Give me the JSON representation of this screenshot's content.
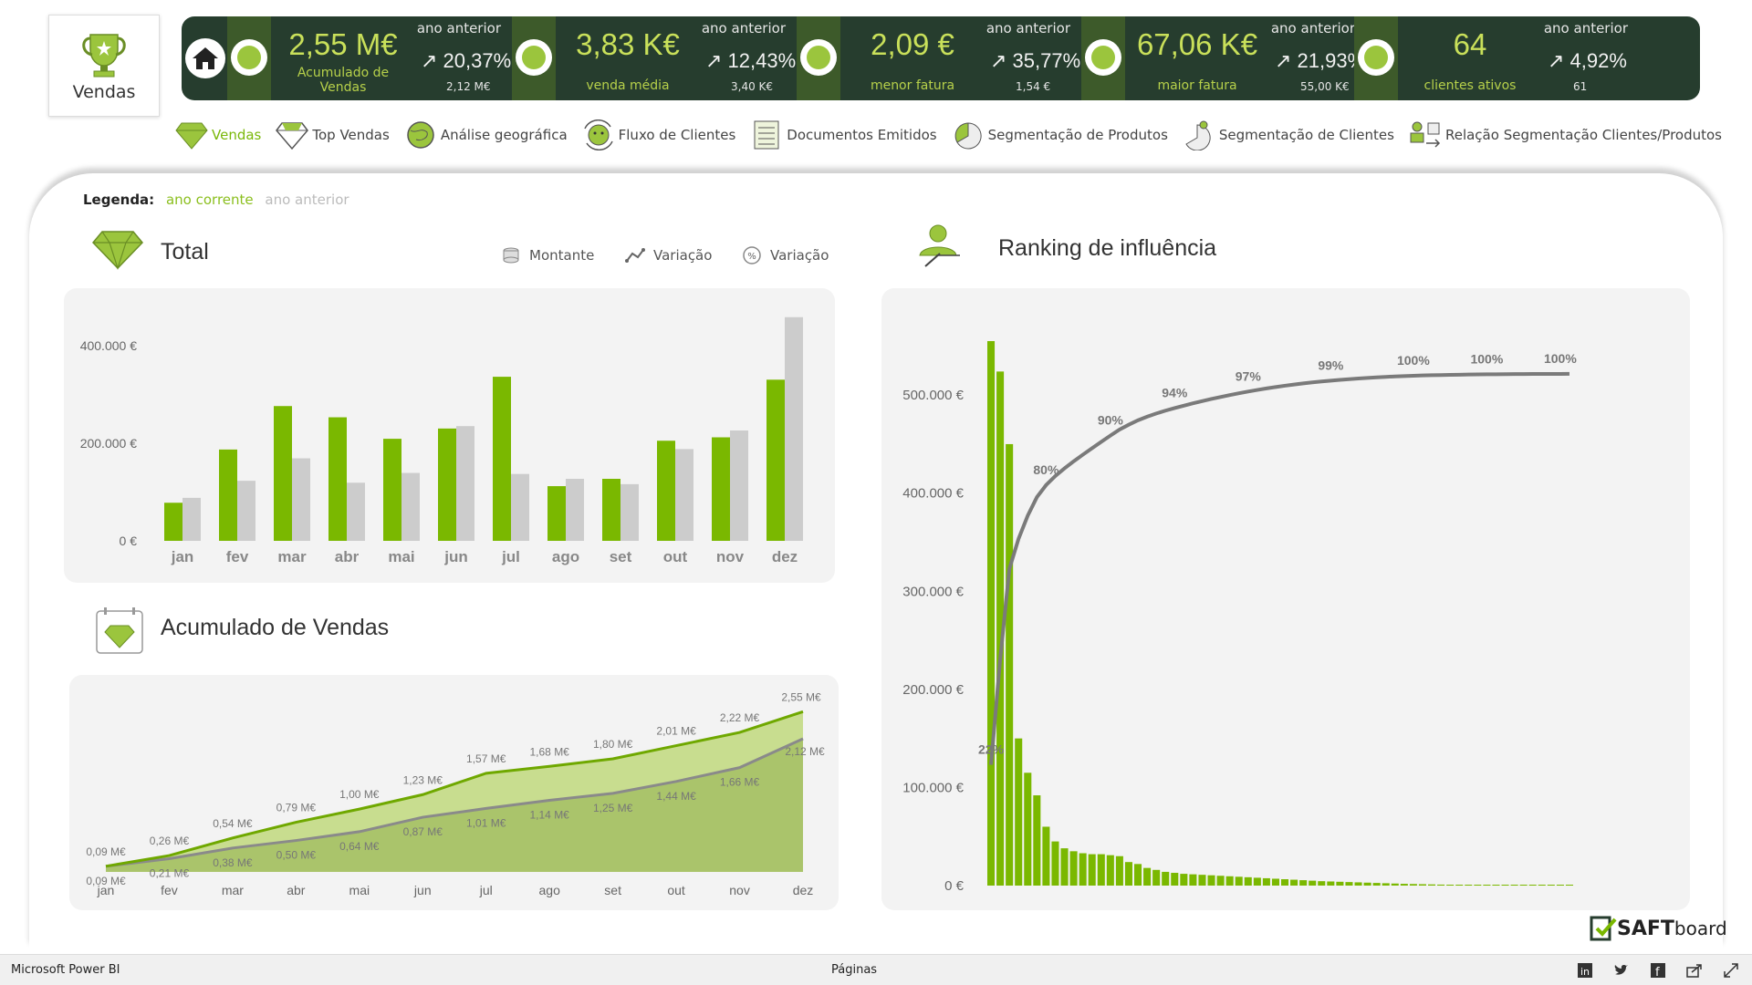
{
  "logo": {
    "label": "Vendas"
  },
  "kpis": [
    {
      "value": "2,55 M€",
      "label": "Acumulado de Vendas",
      "prev_title": "ano anterior",
      "prev_pct": "↗ 20,37%",
      "prev_val": "2,12 M€"
    },
    {
      "value": "3,83 K€",
      "label": "venda média",
      "prev_title": "ano anterior",
      "prev_pct": "↗ 12,43%",
      "prev_val": "3,40 K€"
    },
    {
      "value": "2,09 €",
      "label": "menor fatura",
      "prev_title": "ano anterior",
      "prev_pct": "↗ 35,77%",
      "prev_val": "1,54 €"
    },
    {
      "value": "67,06 K€",
      "label": "maior fatura",
      "prev_title": "ano anterior",
      "prev_pct": "↗ 21,93%",
      "prev_val": "55,00 K€"
    },
    {
      "value": "64",
      "label": "clientes ativos",
      "prev_title": "ano anterior",
      "prev_pct": "↗ 4,92%",
      "prev_val": "61"
    }
  ],
  "nav": [
    {
      "label": "Vendas",
      "icon": "diamond-icon"
    },
    {
      "label": "Top Vendas",
      "icon": "diamond-outline-icon"
    },
    {
      "label": "Análise geográfica",
      "icon": "globe-icon"
    },
    {
      "label": "Fluxo de Clientes",
      "icon": "customer-flow-icon"
    },
    {
      "label": "Documentos Emitidos",
      "icon": "document-icon"
    },
    {
      "label": "Segmentação de Produtos",
      "icon": "product-pie-icon"
    },
    {
      "label": "Segmentação de Clientes",
      "icon": "client-pie-icon"
    },
    {
      "label": "Relação Segmentação Clientes/Produtos",
      "icon": "relation-icon"
    }
  ],
  "legend": {
    "title": "Legenda:",
    "current": "ano corrente",
    "previous": "ano anterior"
  },
  "total": {
    "title": "Total",
    "toggles": [
      "Montante",
      "Variação",
      "Variação"
    ]
  },
  "acumulado": {
    "title": "Acumulado de Vendas"
  },
  "ranking": {
    "title": "Ranking de influência"
  },
  "colors": {
    "current": "#7ab800",
    "previous": "#cccccc",
    "line": "#8a8a8a",
    "dark": "#263d2e"
  },
  "chart_data": [
    {
      "type": "bar",
      "title": "Total",
      "categories": [
        "jan",
        "fev",
        "mar",
        "abr",
        "mai",
        "jun",
        "jul",
        "ago",
        "set",
        "out",
        "nov",
        "dez"
      ],
      "series": [
        {
          "name": "ano corrente",
          "values": [
            78000,
            187000,
            276000,
            253000,
            209000,
            230000,
            336000,
            112000,
            127000,
            205000,
            212000,
            330000
          ]
        },
        {
          "name": "ano anterior",
          "values": [
            88000,
            123000,
            169000,
            119000,
            139000,
            235000,
            137000,
            127000,
            116000,
            188000,
            226000,
            458000
          ]
        }
      ],
      "yticks": [
        "0 €",
        "200.000 €",
        "400.000 €"
      ],
      "ylim": [
        0,
        480000
      ]
    },
    {
      "type": "area",
      "title": "Acumulado de Vendas",
      "categories": [
        "jan",
        "fev",
        "mar",
        "abr",
        "mai",
        "jun",
        "jul",
        "ago",
        "set",
        "out",
        "nov",
        "dez"
      ],
      "series": [
        {
          "name": "ano corrente",
          "values": [
            0.09,
            0.26,
            0.54,
            0.79,
            1.0,
            1.23,
            1.57,
            1.68,
            1.8,
            2.01,
            2.22,
            2.55
          ],
          "labels": [
            "0,09 M€",
            "0,26 M€",
            "0,54 M€",
            "0,79 M€",
            "1,00 M€",
            "1,23 M€",
            "1,57 M€",
            "1,68 M€",
            "1,80 M€",
            "2,01 M€",
            "2,22 M€",
            "2,55 M€"
          ]
        },
        {
          "name": "ano anterior",
          "values": [
            0.09,
            0.21,
            0.38,
            0.5,
            0.64,
            0.87,
            1.01,
            1.14,
            1.25,
            1.44,
            1.66,
            2.12
          ],
          "labels": [
            "0,09 M€",
            "0,21 M€",
            "0,38 M€",
            "0,50 M€",
            "0,64 M€",
            "0,87 M€",
            "1,01 M€",
            "1,14 M€",
            "1,25 M€",
            "1,44 M€",
            "1,66 M€",
            "2,12 M€"
          ]
        }
      ],
      "ylim": [
        0,
        2.7
      ]
    },
    {
      "type": "bar",
      "title": "Ranking de influência",
      "yticks": [
        "0 €",
        "100.000 €",
        "200.000 €",
        "300.000 €",
        "400.000 €",
        "500.000 €"
      ],
      "ylim": [
        0,
        555000
      ],
      "values": [
        555000,
        524000,
        450000,
        150000,
        115000,
        92000,
        60000,
        45000,
        38000,
        35000,
        33000,
        32000,
        32000,
        31000,
        30000,
        24000,
        22000,
        18000,
        16000,
        14000,
        13000,
        12000,
        11500,
        11000,
        10500,
        10000,
        9500,
        9000,
        8500,
        8000,
        7500,
        7000,
        6500,
        6000,
        5500,
        5000,
        4500,
        4200,
        3900,
        3600,
        3300,
        3000,
        2700,
        2400,
        2100,
        1800,
        1600,
        1400,
        1200,
        1000,
        900,
        800,
        700,
        600,
        500,
        450,
        400,
        350,
        300,
        250,
        200,
        150,
        100,
        80
      ],
      "cumulative_labels": [
        "22%",
        "80%",
        "90%",
        "94%",
        "97%",
        "99%",
        "100%",
        "100%",
        "100%"
      ],
      "cumulative_label_ranks": [
        1,
        7,
        14,
        21,
        29,
        38,
        47,
        55,
        63
      ]
    }
  ],
  "footer": {
    "app": "Microsoft Power BI",
    "pages": "Páginas"
  },
  "brand": {
    "name": "SAFT",
    "suffix": "board"
  }
}
